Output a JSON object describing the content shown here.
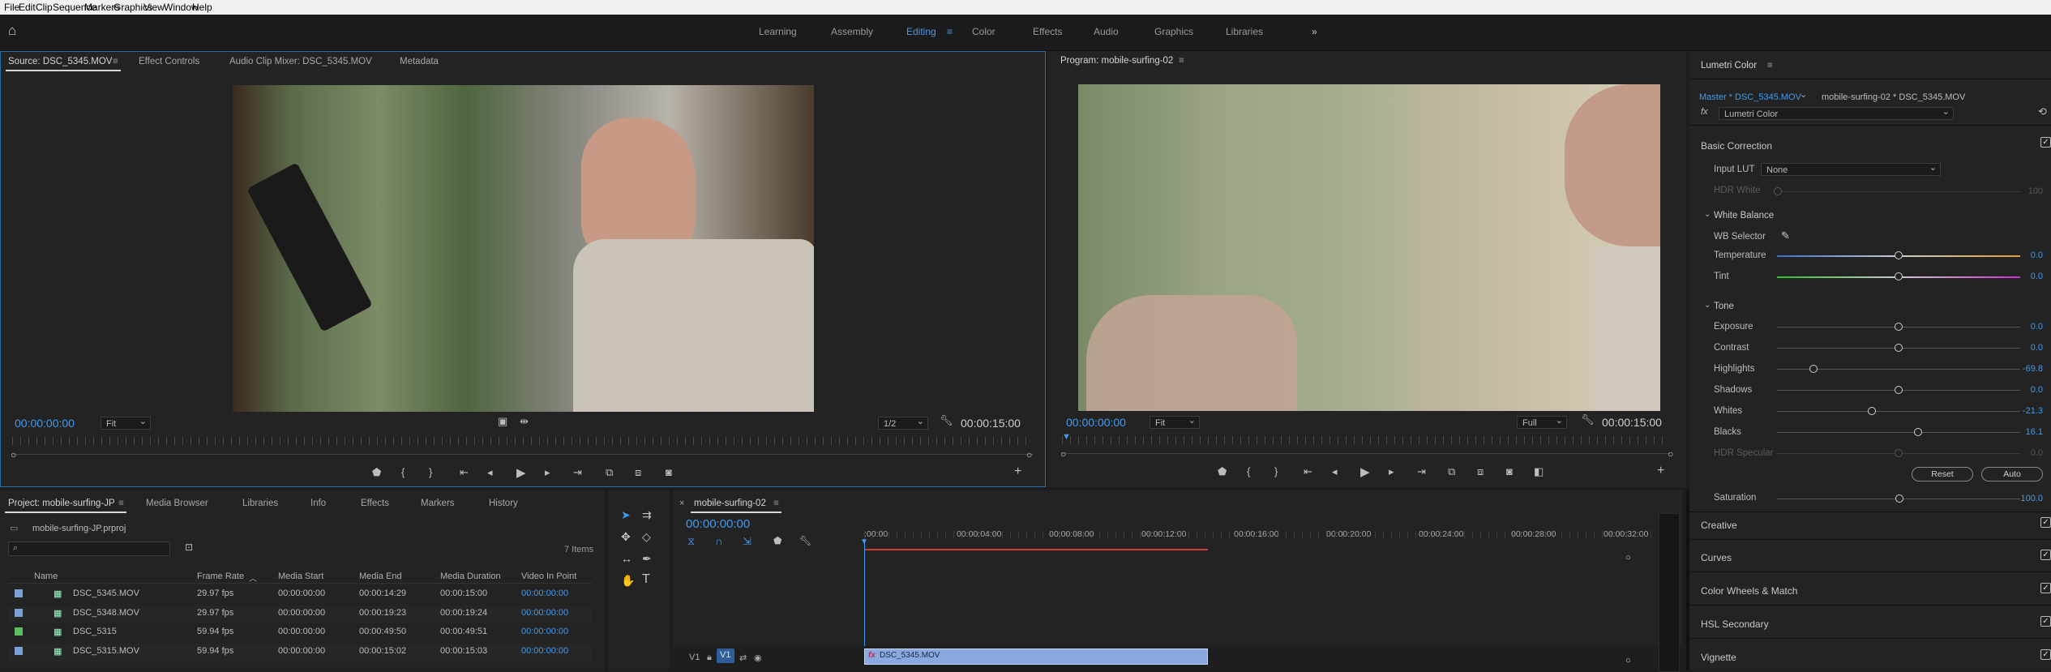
{
  "menu": [
    "File",
    "Edit",
    "Clip",
    "Sequence",
    "Markers",
    "Graphics",
    "View",
    "Window",
    "Help"
  ],
  "workspaces": [
    "Learning",
    "Assembly",
    "Editing",
    "Color",
    "Effects",
    "Audio",
    "Graphics",
    "Libraries"
  ],
  "active_workspace": "Editing",
  "source": {
    "tabs": [
      "Source: DSC_5345.MOV",
      "Effect Controls",
      "Audio Clip Mixer: DSC_5345.MOV",
      "Metadata"
    ],
    "timecode": "00:00:00:00",
    "fit": "Fit",
    "resolution": "1/2",
    "duration": "00:00:15:00"
  },
  "program": {
    "title": "Program: mobile-surfing-02",
    "timecode": "00:00:00:00",
    "fit": "Fit",
    "resolution": "Full",
    "duration": "00:00:15:00"
  },
  "lumetri": {
    "title": "Lumetri Color",
    "master": "Master * DSC_5345.MOV",
    "sequence_clip": "mobile-surfing-02 * DSC_5345.MOV",
    "effect": "Lumetri Color",
    "basic_correction": "Basic Correction",
    "input_lut_label": "Input LUT",
    "input_lut_value": "None",
    "hdr_white_label": "HDR White",
    "hdr_white_value": "100",
    "white_balance": "White Balance",
    "wb_selector": "WB Selector",
    "tone": "Tone",
    "sliders": [
      {
        "label": "Temperature",
        "value": "0.0",
        "pos": 0.5
      },
      {
        "label": "Tint",
        "value": "0.0",
        "pos": 0.5
      },
      {
        "label": "Exposure",
        "value": "0.0",
        "pos": 0.5
      },
      {
        "label": "Contrast",
        "value": "0.0",
        "pos": 0.5
      },
      {
        "label": "Highlights",
        "value": "-69.8",
        "pos": 0.15
      },
      {
        "label": "Shadows",
        "value": "0.0",
        "pos": 0.5
      },
      {
        "label": "Whites",
        "value": "-21.3",
        "pos": 0.39
      },
      {
        "label": "Blacks",
        "value": "16.1",
        "pos": 0.58
      },
      {
        "label": "HDR Specular",
        "value": "0.0",
        "pos": 0.5
      }
    ],
    "reset": "Reset",
    "auto": "Auto",
    "saturation_label": "Saturation",
    "saturation_value": "100.0",
    "sections": [
      "Creative",
      "Curves",
      "Color Wheels & Match",
      "HSL Secondary",
      "Vignette"
    ]
  },
  "project": {
    "tabs": [
      "Project: mobile-surfing-JP",
      "Media Browser",
      "Libraries",
      "Info",
      "Effects",
      "Markers",
      "History"
    ],
    "file": "mobile-surfing-JP.prproj",
    "items_count": "7 Items",
    "columns": [
      "Name",
      "Frame Rate",
      "Media Start",
      "Media End",
      "Media Duration",
      "Video In Point"
    ],
    "rows": [
      {
        "name": "DSC_5345.MOV",
        "rate": "29.97 fps",
        "start": "00:00:00:00",
        "end": "00:00:14:29",
        "dur": "00:00:15:00",
        "vin": "00:00:00:00",
        "color": "#7b9fd6"
      },
      {
        "name": "DSC_5348.MOV",
        "rate": "29.97 fps",
        "start": "00:00:00:00",
        "end": "00:00:19:23",
        "dur": "00:00:19:24",
        "vin": "00:00:00:00",
        "color": "#7b9fd6"
      },
      {
        "name": "DSC_5315",
        "rate": "59.94 fps",
        "start": "00:00:00:00",
        "end": "00:00:49:50",
        "dur": "00:00:49:51",
        "vin": "00:00:00:00",
        "color": "#5fbf5f"
      },
      {
        "name": "DSC_5315.MOV",
        "rate": "59.94 fps",
        "start": "00:00:00:00",
        "end": "00:00:15:02",
        "dur": "00:00:15:03",
        "vin": "00:00:00:00",
        "color": "#7b9fd6"
      }
    ]
  },
  "timeline": {
    "sequence": "mobile-surfing-02",
    "timecode": "00:00:00:00",
    "ticks": [
      ":00:00",
      "00:00:04:00",
      "00:00:08:00",
      "00:00:12:00",
      "00:00:16:00",
      "00:00:20:00",
      "00:00:24:00",
      "00:00:28:00",
      "00:00:32:00"
    ],
    "track_source": "V1",
    "track_target": "V1",
    "clip_name": "DSC_5345.MOV",
    "clip_fx": "fx"
  }
}
